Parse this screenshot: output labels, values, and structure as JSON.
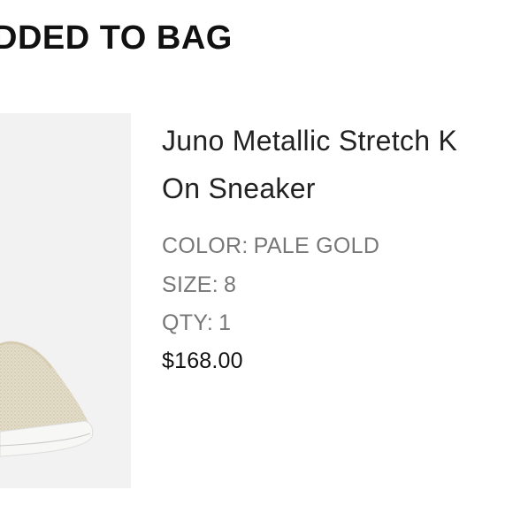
{
  "header": {
    "title": "DDED TO BAG"
  },
  "product": {
    "image_icon": "sneaker-image",
    "name": "Juno Metallic Stretch Knit Slip-On Sneaker",
    "name_visible_line1": "Juno Metallic Stretch K",
    "name_visible_line2": "On Sneaker",
    "color_label": "COLOR:",
    "color_value": "PALE GOLD",
    "size_label": "SIZE:",
    "size_value": "8",
    "qty_label": "QTY:",
    "qty_value": "1",
    "price": "$168.00"
  }
}
